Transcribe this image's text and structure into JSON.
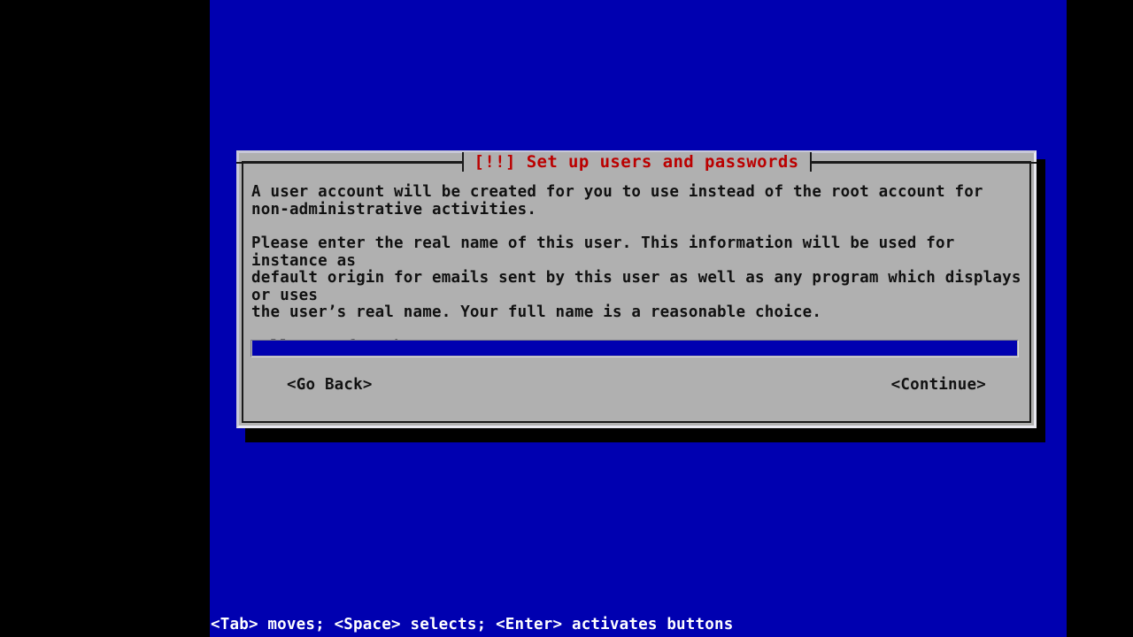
{
  "screen": {
    "background_color": "#000000",
    "console_background_color": "#0000b0"
  },
  "dialog": {
    "title": "[!!] Set up users and passwords",
    "title_color": "#bb0000",
    "background_color": "#b0b0b0",
    "paragraphs": [
      "A user account will be created for you to use instead of the root account for\nnon-administrative activities.",
      "Please enter the real name of this user. This information will be used for instance as\ndefault origin for emails sent by this user as well as any program which displays or uses\nthe user’s real name. Your full name is a reasonable choice.",
      "Full name for the new user:"
    ],
    "input": {
      "value": "",
      "placeholder": "",
      "background_color": "#0000b0",
      "text_color": "#ffffff"
    },
    "buttons": {
      "go_back": "<Go Back>",
      "continue": "<Continue>"
    }
  },
  "status_bar": {
    "text": "<Tab> moves; <Space> selects; <Enter> activates buttons",
    "background_color": "#0000b0",
    "text_color": "#ffffff"
  }
}
